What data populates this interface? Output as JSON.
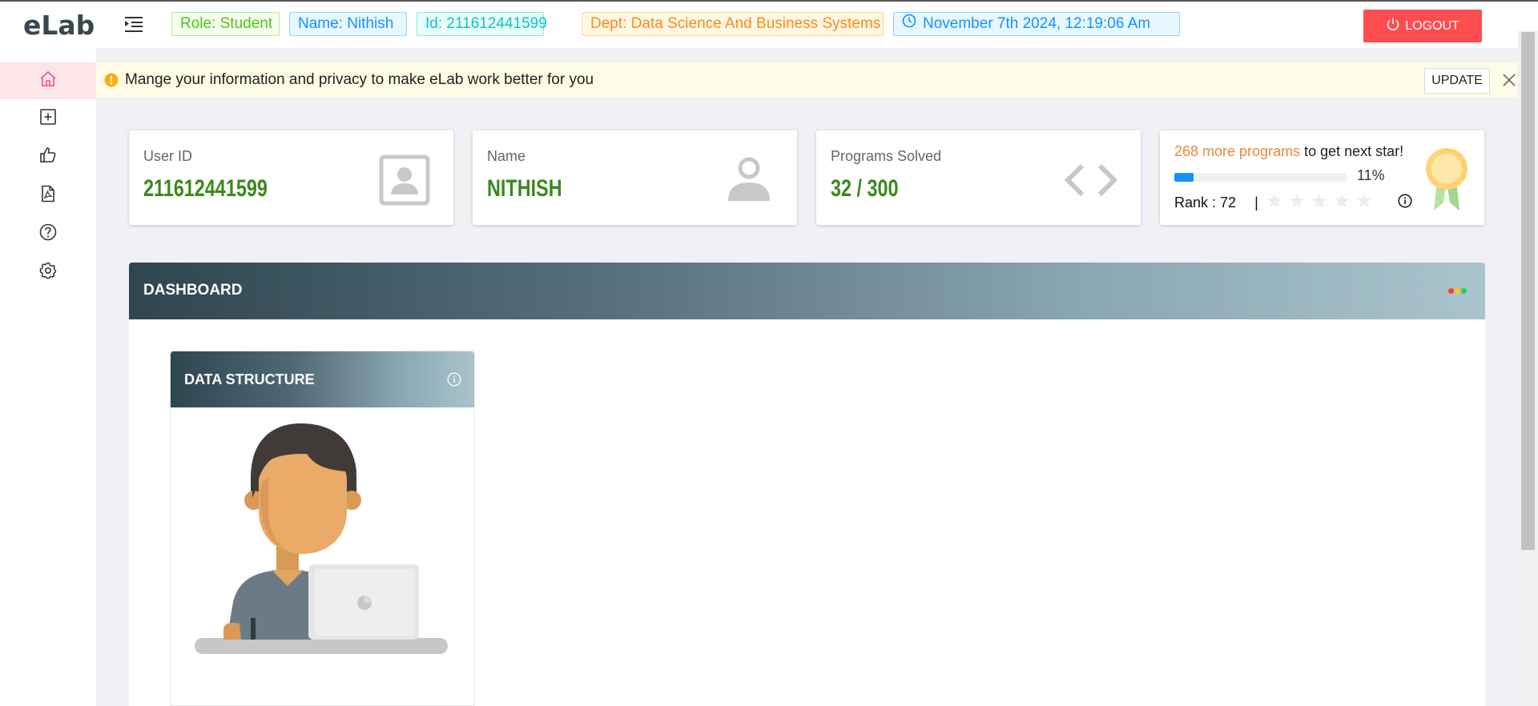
{
  "app": {
    "logo": "eLab"
  },
  "header": {
    "role": "Role: Student",
    "name": "Name: Nithish",
    "id": "Id: 211612441599",
    "dept": "Dept: Data Science And Business Systems",
    "datetime": "November 7th 2024, 12:19:06 Am",
    "logout_label": "Logout"
  },
  "sidebar": {
    "items": [
      {
        "icon": "home-icon"
      },
      {
        "icon": "plus-square-icon"
      },
      {
        "icon": "thumbs-up-icon"
      },
      {
        "icon": "pdf-file-icon"
      },
      {
        "icon": "help-circle-icon"
      },
      {
        "icon": "settings-gear-icon"
      }
    ],
    "active_color": "#fde5ea"
  },
  "notice": {
    "text": "Mange your information and privacy to make eLab work better for you",
    "update_label": "UPDATE"
  },
  "cards": {
    "user_id": {
      "label": "User ID",
      "value": "211612441599"
    },
    "name": {
      "label": "Name",
      "value": "NITHISH"
    },
    "programs": {
      "label": "Programs Solved",
      "value": "32 / 300"
    },
    "star": {
      "highlight": "268 more programs",
      "rest": " to get next star!",
      "progress_percent": 11,
      "progress_text": "11%",
      "rank_text": "Rank : 72",
      "separator": "|",
      "stars_filled": 0,
      "stars_total": 5
    }
  },
  "dashboard": {
    "title": "DASHBOARD",
    "dot_colors": [
      "#ff3b30",
      "#ffcc00",
      "#34c759"
    ]
  },
  "courses": [
    {
      "title": "DATA STRUCTURE"
    }
  ],
  "colors": {
    "logout": "#ff4d4f",
    "value_green": "#3a8a1c",
    "highlight_orange": "#e8883a",
    "progress_blue": "#1890ff"
  }
}
